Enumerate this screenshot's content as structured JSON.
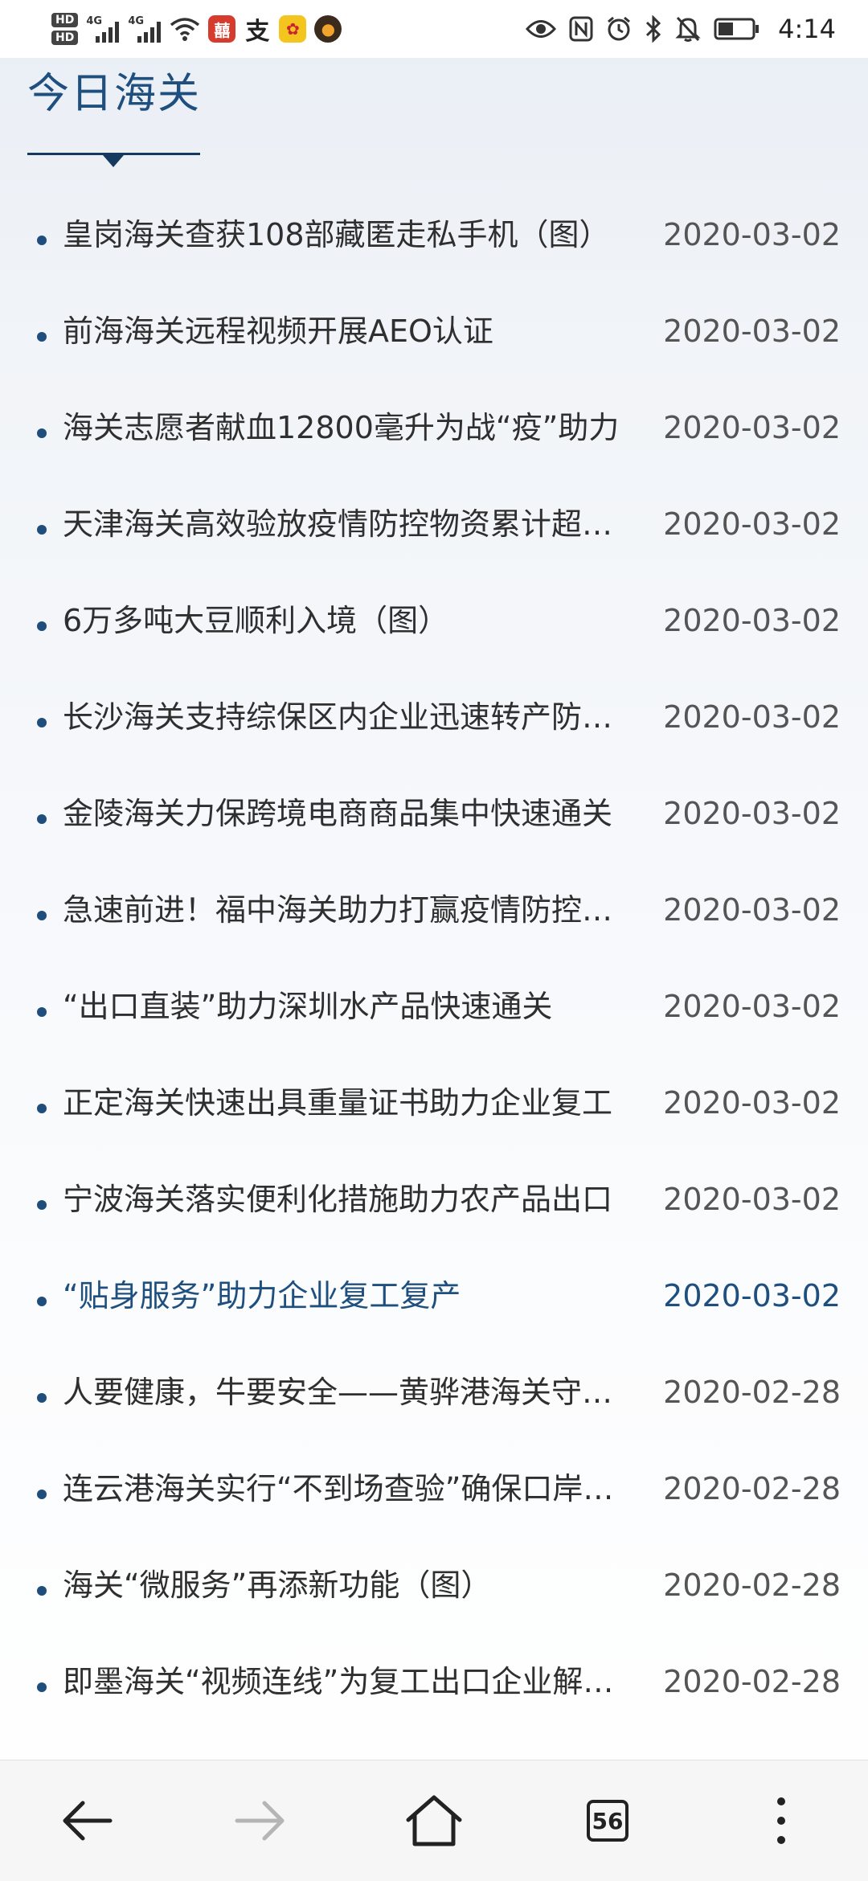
{
  "status_bar": {
    "hd1": "HD",
    "hd2": "HD",
    "net1": "4G",
    "net2": "4G",
    "time": "4:14",
    "left_icons": [
      "wifi-icon",
      "app-red-icon",
      "alipay-icon",
      "app-yellow-icon",
      "app-dark-icon"
    ],
    "right_icons": [
      "eye-icon",
      "nfc-icon",
      "alarm-icon",
      "bluetooth-icon",
      "mute-icon",
      "battery-icon"
    ],
    "battery_level": 0.45
  },
  "header": {
    "title": "今日海关"
  },
  "news": [
    {
      "title": "皇岗海关查获108部藏匿走私手机（图）",
      "date": "2020-03-02"
    },
    {
      "title": "前海海关远程视频开展AEO认证",
      "date": "2020-03-02"
    },
    {
      "title": "海关志愿者献血12800毫升为战“疫”助力",
      "date": "2020-03-02"
    },
    {
      "title": "天津海关高效验放疫情防控物资累计超千吨",
      "date": "2020-03-02"
    },
    {
      "title": "6万多吨大豆顺利入境（图）",
      "date": "2020-03-02"
    },
    {
      "title": "长沙海关支持综保区内企业迅速转产防疫物资",
      "date": "2020-03-02"
    },
    {
      "title": "金陵海关力保跨境电商商品集中快速通关",
      "date": "2020-03-02"
    },
    {
      "title": "急速前进！福中海关助力打赢疫情防控阻击战",
      "date": "2020-03-02"
    },
    {
      "title": "“出口直装”助力深圳水产品快速通关",
      "date": "2020-03-02"
    },
    {
      "title": "正定海关快速出具重量证书助力企业复工",
      "date": "2020-03-02"
    },
    {
      "title": "宁波海关落实便利化措施助力农产品出口",
      "date": "2020-03-02"
    },
    {
      "title": "“贴身服务”助力企业复工复产",
      "date": "2020-03-02",
      "active": true
    },
    {
      "title": "人要健康，牛要安全——黄骅港海关守护国门",
      "date": "2020-02-28"
    },
    {
      "title": "连云港海关实行“不到场查验”确保口岸通畅",
      "date": "2020-02-28"
    },
    {
      "title": "海关“微服务”再添新功能（图）",
      "date": "2020-02-28"
    },
    {
      "title": "即墨海关“视频连线”为复工出口企业解难题",
      "date": "2020-02-28"
    }
  ],
  "bottom_nav": {
    "items": [
      "back-icon",
      "forward-icon",
      "home-icon",
      "tabs-icon",
      "more-icon"
    ],
    "tab_count": "56"
  },
  "colors": {
    "accent": "#1e4f7e",
    "text": "#2f2f2f",
    "date": "#555555",
    "bullet": "#1f4e7c"
  }
}
